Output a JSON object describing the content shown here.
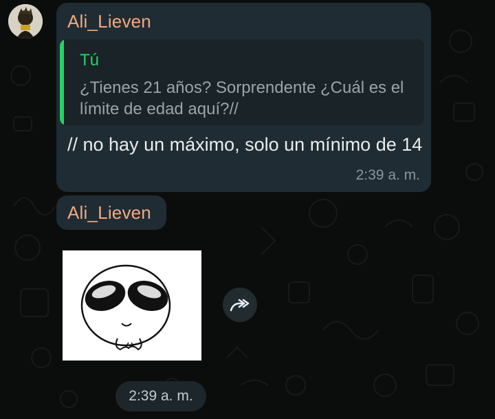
{
  "message1": {
    "sender": "Ali_Lieven",
    "quoted": {
      "author": "Tú",
      "text": "¿Tienes 21 años? Sorprendente ¿Cuál es el límite de edad aquí?//"
    },
    "text": "// no hay un máximo, solo un mínimo de 14",
    "time": "2:39 a. m."
  },
  "message2": {
    "sender": "Ali_Lieven",
    "sticker_icon": "sunglasses-face-sticker",
    "forward_icon": "forward-icon",
    "time": "2:39 a. m."
  },
  "colors": {
    "background": "#0b0d0c",
    "bubble": "#202c33",
    "sender": "#f2a882",
    "quote_accent": "#25d366",
    "text": "#e9edef",
    "timestamp": "#8a969d"
  }
}
